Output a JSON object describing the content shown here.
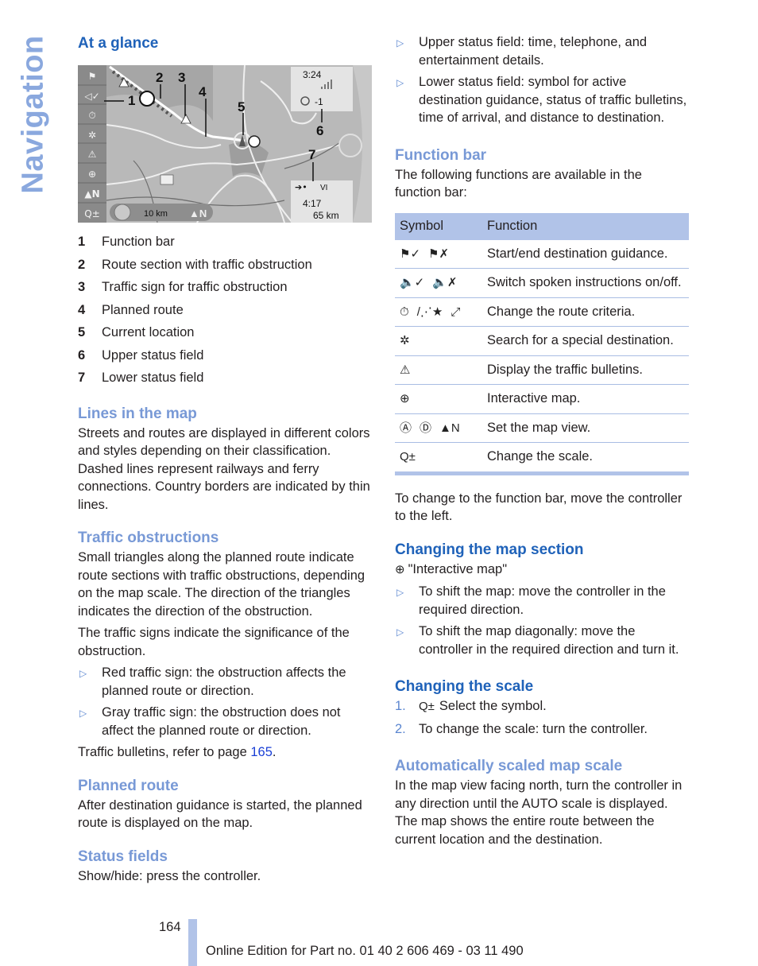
{
  "side_tab": "Navigation",
  "left": {
    "at_a_glance": {
      "heading": "At a glance",
      "map": {
        "callouts": [
          "1",
          "2",
          "3",
          "4",
          "5",
          "6",
          "7"
        ],
        "upper_status": {
          "time": "3:24",
          "value": "-1"
        },
        "lower_status": {
          "route": "VI",
          "arrival": "4:17",
          "distance": "65 km"
        },
        "scale": "10 km",
        "north": "N"
      },
      "legend": [
        {
          "num": "1",
          "label": "Function bar"
        },
        {
          "num": "2",
          "label": "Route section with traffic obstruction"
        },
        {
          "num": "3",
          "label": "Traffic sign for traffic obstruction"
        },
        {
          "num": "4",
          "label": "Planned route"
        },
        {
          "num": "5",
          "label": "Current location"
        },
        {
          "num": "6",
          "label": "Upper status field"
        },
        {
          "num": "7",
          "label": "Lower status field"
        }
      ]
    },
    "lines": {
      "heading": "Lines in the map",
      "text": "Streets and routes are displayed in different colors and styles depending on their classification. Dashed lines represent railways and ferry connections. Country borders are indicated by thin lines."
    },
    "traffic": {
      "heading": "Traffic obstructions",
      "p1": "Small triangles along the planned route indicate route sections with traffic obstructions, depending on the map scale. The direction of the triangles indicates the direction of the obstruction.",
      "p2": "The traffic signs indicate the significance of the obstruction.",
      "bullets": [
        "Red traffic sign: the obstruction affects the planned route or direction.",
        "Gray traffic sign: the obstruction does not affect the planned route or direction."
      ],
      "ref_text": "Traffic bulletins, refer to page ",
      "ref_page": "165",
      "ref_end": "."
    },
    "planned": {
      "heading": "Planned route",
      "text": "After destination guidance is started, the planned route is displayed on the map."
    },
    "status": {
      "heading": "Status fields",
      "text": "Show/hide: press the controller."
    }
  },
  "right": {
    "status_bullets": [
      "Upper status field: time, telephone, and entertainment details.",
      "Lower status field: symbol for active destination guidance, status of traffic bulletins, time of arrival, and distance to destination."
    ],
    "function_bar": {
      "heading": "Function bar",
      "intro": "The following functions are available in the function bar:",
      "table": {
        "headers": [
          "Symbol",
          "Function"
        ],
        "rows": [
          {
            "icons": [
              "guidance-start-icon",
              "guidance-end-icon"
            ],
            "glyphs": [
              "⚑✓",
              "⚑✗"
            ],
            "function": "Start/end destination guidance."
          },
          {
            "icons": [
              "speaker-on-icon",
              "speaker-off-icon"
            ],
            "glyphs": [
              "🔈✓",
              "🔈✗"
            ],
            "function": "Switch spoken instructions on/off."
          },
          {
            "icons": [
              "fast-route-icon",
              "scenic-route-icon",
              "short-route-icon"
            ],
            "glyphs": [
              "⏱",
              "/⋰★",
              "⤢"
            ],
            "function": "Change the route criteria."
          },
          {
            "icons": [
              "special-destination-icon"
            ],
            "glyphs": [
              "✲"
            ],
            "function": "Search for a special destination."
          },
          {
            "icons": [
              "traffic-warning-icon"
            ],
            "glyphs": [
              "⚠"
            ],
            "function": "Display the traffic bulletins."
          },
          {
            "icons": [
              "interactive-map-icon"
            ],
            "glyphs": [
              "⊕"
            ],
            "function": "Interactive map."
          },
          {
            "icons": [
              "direction-of-travel-icon",
              "perspective-icon",
              "north-up-icon"
            ],
            "glyphs": [
              "Ⓐ",
              "Ⓓ",
              "▲N"
            ],
            "function": "Set the map view."
          },
          {
            "icons": [
              "zoom-scale-icon"
            ],
            "glyphs": [
              "Q±"
            ],
            "function": "Change the scale."
          }
        ]
      },
      "after": "To change to the function bar, move the controller to the left."
    },
    "map_section": {
      "heading": "Changing the map section",
      "icon_label": "\"Interactive map\"",
      "bullets": [
        "To shift the map: move the controller in the required direction.",
        "To shift the map diagonally: move the controller in the required direction and turn it."
      ]
    },
    "scale": {
      "heading": "Changing the scale",
      "steps": [
        {
          "n": "1.",
          "text": "Select the symbol."
        },
        {
          "n": "2.",
          "text": "To change the scale: turn the controller."
        }
      ]
    },
    "auto_scale": {
      "heading": "Automatically scaled map scale",
      "text": "In the map view facing north, turn the controller in any direction until the AUTO scale is displayed. The map shows the entire route between the current location and the destination."
    }
  },
  "footer": {
    "page_number": "164",
    "text": "Online Edition for Part no. 01 40 2 606 469 - 03 11 490"
  },
  "colors": {
    "heading_dark": "#1f62b9",
    "heading_light": "#7899d6",
    "table_header": "#b1c3e8",
    "side_tab": "#8aa8de"
  }
}
